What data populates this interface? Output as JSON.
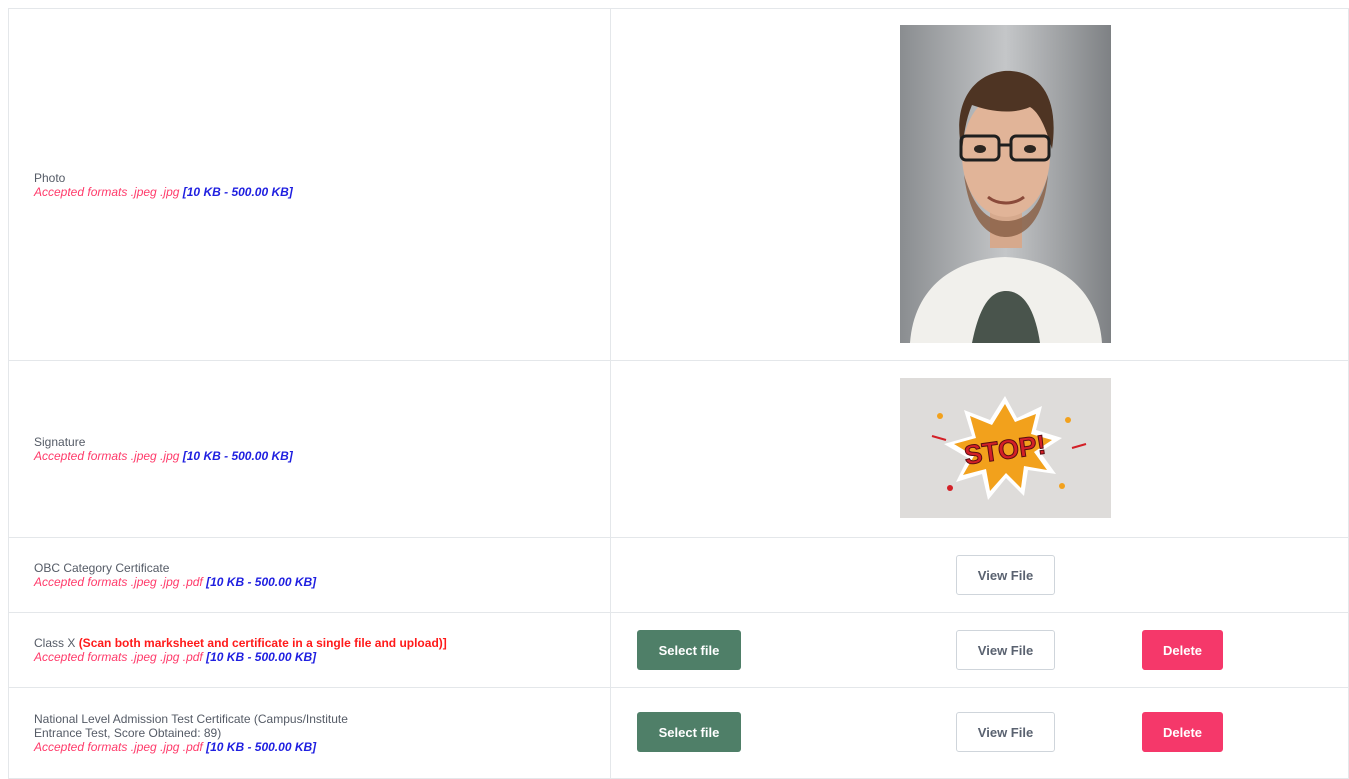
{
  "rows": [
    {
      "label": "Photo",
      "formats": "Accepted formats .jpeg .jpg",
      "size": "[10 KB - 500.00 KB]"
    },
    {
      "label": "Signature",
      "formats": "Accepted formats .jpeg .jpg",
      "size": "[10 KB - 500.00 KB]",
      "image_text": "STOP!"
    },
    {
      "label": "OBC Category Certificate",
      "formats": "Accepted formats .jpeg .jpg .pdf",
      "size": "[10 KB - 500.00 KB]",
      "view_label": "View File"
    },
    {
      "label": "Class X",
      "note": "(Scan both marksheet and certificate in a single file and upload)]",
      "formats": "Accepted formats .jpeg .jpg .pdf",
      "size": "[10 KB - 500.00 KB]",
      "select_label": "Select file",
      "view_label": "View File",
      "delete_label": "Delete"
    },
    {
      "label_line1": "National Level Admission Test Certificate (Campus/Institute",
      "label_line2": "Entrance Test, Score Obtained: 89)",
      "formats": "Accepted formats .jpeg .jpg .pdf",
      "size": "[10 KB - 500.00 KB]",
      "select_label": "Select file",
      "view_label": "View File",
      "delete_label": "Delete"
    }
  ],
  "colors": {
    "select_button": "#4f7f68",
    "delete_button": "#f5386a",
    "format_text": "#ff3a6a",
    "size_text": "#1f1fe0",
    "warning_text": "#ff1a1a"
  }
}
